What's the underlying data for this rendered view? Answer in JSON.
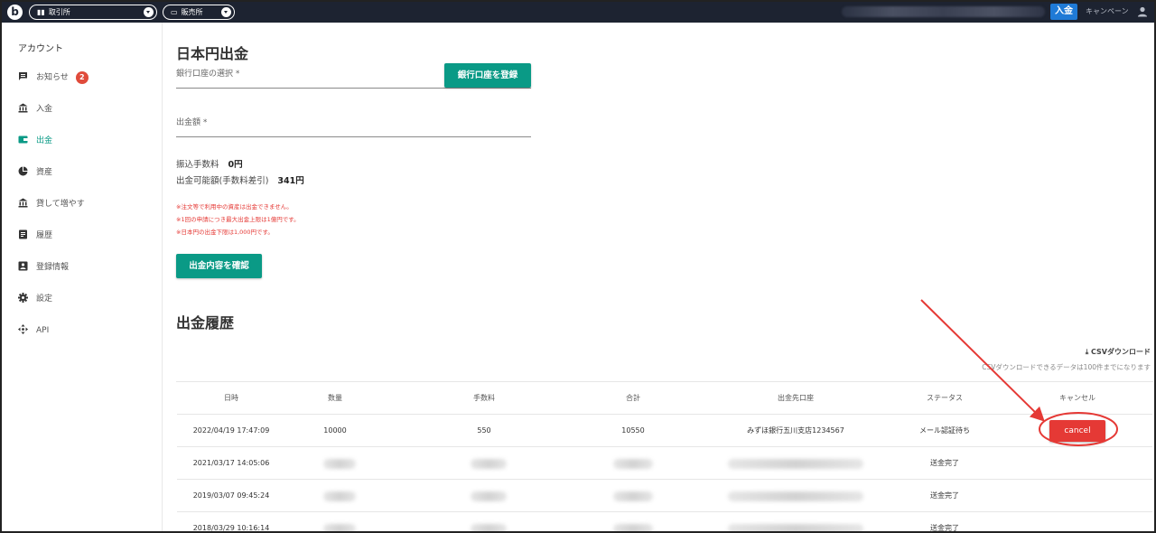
{
  "topbar": {
    "logo": "b",
    "exchange_label": "取引所",
    "sales_label": "販売所",
    "deposit_label": "入金",
    "campaign_label": "キャンペーン"
  },
  "sidebar": {
    "heading": "アカウント",
    "items": [
      {
        "label": "お知らせ",
        "icon": "message-icon",
        "badge": "2"
      },
      {
        "label": "入金",
        "icon": "bank-icon"
      },
      {
        "label": "出金",
        "icon": "wallet-icon",
        "active": true
      },
      {
        "label": "資産",
        "icon": "pie-chart-icon"
      },
      {
        "label": "貸して増やす",
        "icon": "bank-icon"
      },
      {
        "label": "履歴",
        "icon": "list-icon"
      },
      {
        "label": "登録情報",
        "icon": "id-card-icon"
      },
      {
        "label": "設定",
        "icon": "gear-icon"
      },
      {
        "label": "API",
        "icon": "api-icon"
      }
    ]
  },
  "withdraw": {
    "title": "日本円出金",
    "bank_select_label": "銀行口座の選択 *",
    "register_bank_button": "銀行口座を登録",
    "amount_label": "出金額 *",
    "fee_label": "振込手数料",
    "fee_value": "0円",
    "available_label": "出金可能額(手数料差引)",
    "available_value": "341円",
    "notices": [
      "※注文等で利用中の資産は出金できません。",
      "※1回の申請につき最大出金上限は1億円です。",
      "※日本円の出金下限は1,000円です。"
    ],
    "confirm_button": "出金内容を確認"
  },
  "history": {
    "title": "出金履歴",
    "csv_download": "CSVダウンロード",
    "csv_note": "CSVダウンロードできるデータは100件までになります",
    "columns": [
      "日時",
      "数量",
      "手数料",
      "合計",
      "出金先口座",
      "ステータス",
      "キャンセル"
    ],
    "rows": [
      {
        "date": "2022/04/19 17:47:09",
        "amount": "10000",
        "fee": "550",
        "total": "10550",
        "account": "みずほ銀行五川支店1234567",
        "status": "メール認証待ち",
        "cancel": "cancel"
      },
      {
        "date": "2021/03/17 14:05:06",
        "status": "送金完了"
      },
      {
        "date": "2019/03/07 09:45:24",
        "status": "送金完了"
      },
      {
        "date": "2018/03/29 10:16:14",
        "status": "送金完了"
      }
    ]
  },
  "colors": {
    "accent": "#0a9a86",
    "danger": "#e53935",
    "topbar": "#1d2331",
    "deposit": "#1f7ad6"
  }
}
